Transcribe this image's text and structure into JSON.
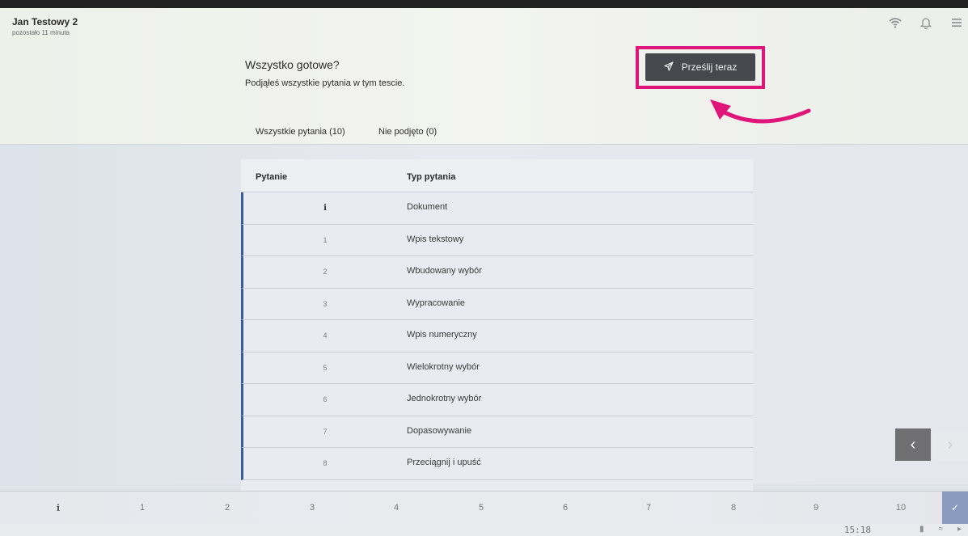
{
  "header": {
    "user_name": "Jan Testowy 2",
    "time_left": "pozostało 11 minuta",
    "title": "Wszystko gotowe?",
    "subtitle": "Podjąłeś wszystkie pytania w tym tescie.",
    "submit_label": "Prześlij teraz",
    "tabs": [
      {
        "label": "Wszystkie pytania (10)"
      },
      {
        "label": "Nie podjęto (0)"
      }
    ]
  },
  "table": {
    "columns": [
      "Pytanie",
      "Typ pytania"
    ],
    "rows": [
      {
        "num": "i",
        "type": "Dokument"
      },
      {
        "num": "1",
        "type": "Wpis tekstowy"
      },
      {
        "num": "2",
        "type": "Wbudowany wybór"
      },
      {
        "num": "3",
        "type": "Wypracowanie"
      },
      {
        "num": "4",
        "type": "Wpis numeryczny"
      },
      {
        "num": "5",
        "type": "Wielokrotny wybór"
      },
      {
        "num": "6",
        "type": "Jednokrotny wybór"
      },
      {
        "num": "7",
        "type": "Dopasowywanie"
      },
      {
        "num": "8",
        "type": "Przeciągnij i upuść"
      }
    ]
  },
  "question_nav": [
    "i",
    "1",
    "2",
    "3",
    "4",
    "5",
    "6",
    "7",
    "8",
    "9",
    "10"
  ],
  "status": {
    "clock": "15:18"
  },
  "colors": {
    "highlight": "#e0157a",
    "submit_button": "#45484d",
    "row_accent": "#3a5a9a"
  },
  "icons": {
    "wifi": "wifi-icon",
    "bell": "bell-icon",
    "menu": "menu-icon",
    "send": "send-icon"
  }
}
